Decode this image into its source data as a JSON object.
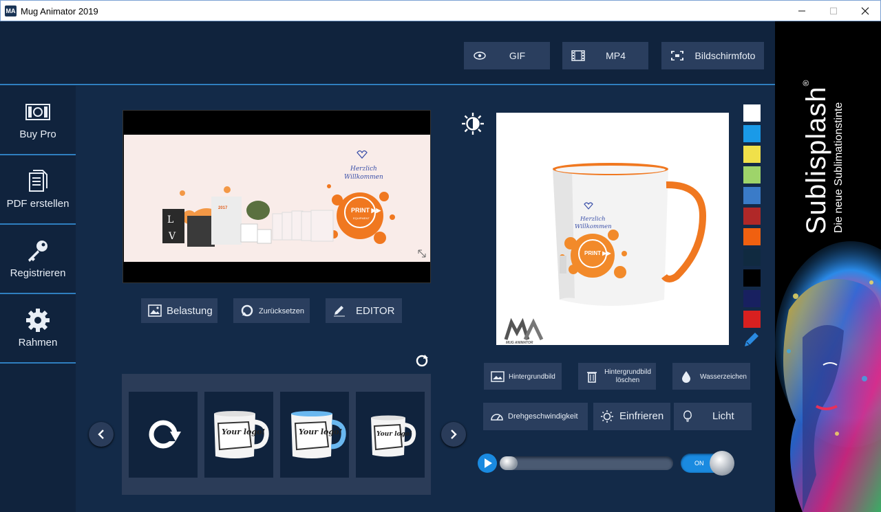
{
  "window": {
    "title": "Mug Animator 2019",
    "icon_text": "MA"
  },
  "toolbar": {
    "gif_label": "GIF",
    "mp4_label": "MP4",
    "screenshot_label": "Bildschirmfoto"
  },
  "sidebar": {
    "items": [
      {
        "label": "Buy Pro",
        "icon": "money-icon"
      },
      {
        "label": "PDF erstellen",
        "icon": "document-icon"
      },
      {
        "label": "Registrieren",
        "icon": "key-icon"
      },
      {
        "label": "Rahmen",
        "icon": "gear-icon"
      }
    ]
  },
  "preview": {
    "heading_line1": "Herzlich",
    "heading_line2": "Willkommen",
    "badge_text": "PRINT ▶▶",
    "badge_sub": "EQUIPMENT",
    "year_text": "2017"
  },
  "editor_buttons": {
    "upload_label": "Belastung",
    "reset_label": "Zurücksetzen",
    "editor_label": "EDITOR"
  },
  "carousel": {
    "thumb_text": "Your logo!"
  },
  "mug": {
    "heading_line1": "Herzlich",
    "heading_line2": "Willkommen",
    "badge_text": "PRINT ▶▶",
    "watermark_text": "MUG ANIMATOR",
    "handle_color": "#f07820"
  },
  "swatches": [
    "#ffffff",
    "#1a9ae8",
    "#f0e04a",
    "#9ed46a",
    "#3a7bc8",
    "#b02828",
    "#f06010",
    "#102a40",
    "#000000",
    "#182060",
    "#d82020"
  ],
  "image_buttons": {
    "background_label": "Hintergrundbild",
    "delete_background_label_line1": "Hintergrundbild",
    "delete_background_label_line2": "löschen",
    "watermark_label": "Wasserzeichen"
  },
  "animation_buttons": {
    "speed_label": "Drehgeschwindigkeit",
    "freeze_label": "Einfrieren",
    "light_label": "Licht"
  },
  "playback": {
    "progress": 0.0,
    "toggle_label": "ON"
  },
  "ad": {
    "brand": "Sublisplash",
    "registered": "®",
    "tagline": "Die neue Sublimationstinte"
  },
  "colors": {
    "accent": "#2f7fc0",
    "background": "#10233d",
    "button": "#2a3e5e"
  }
}
